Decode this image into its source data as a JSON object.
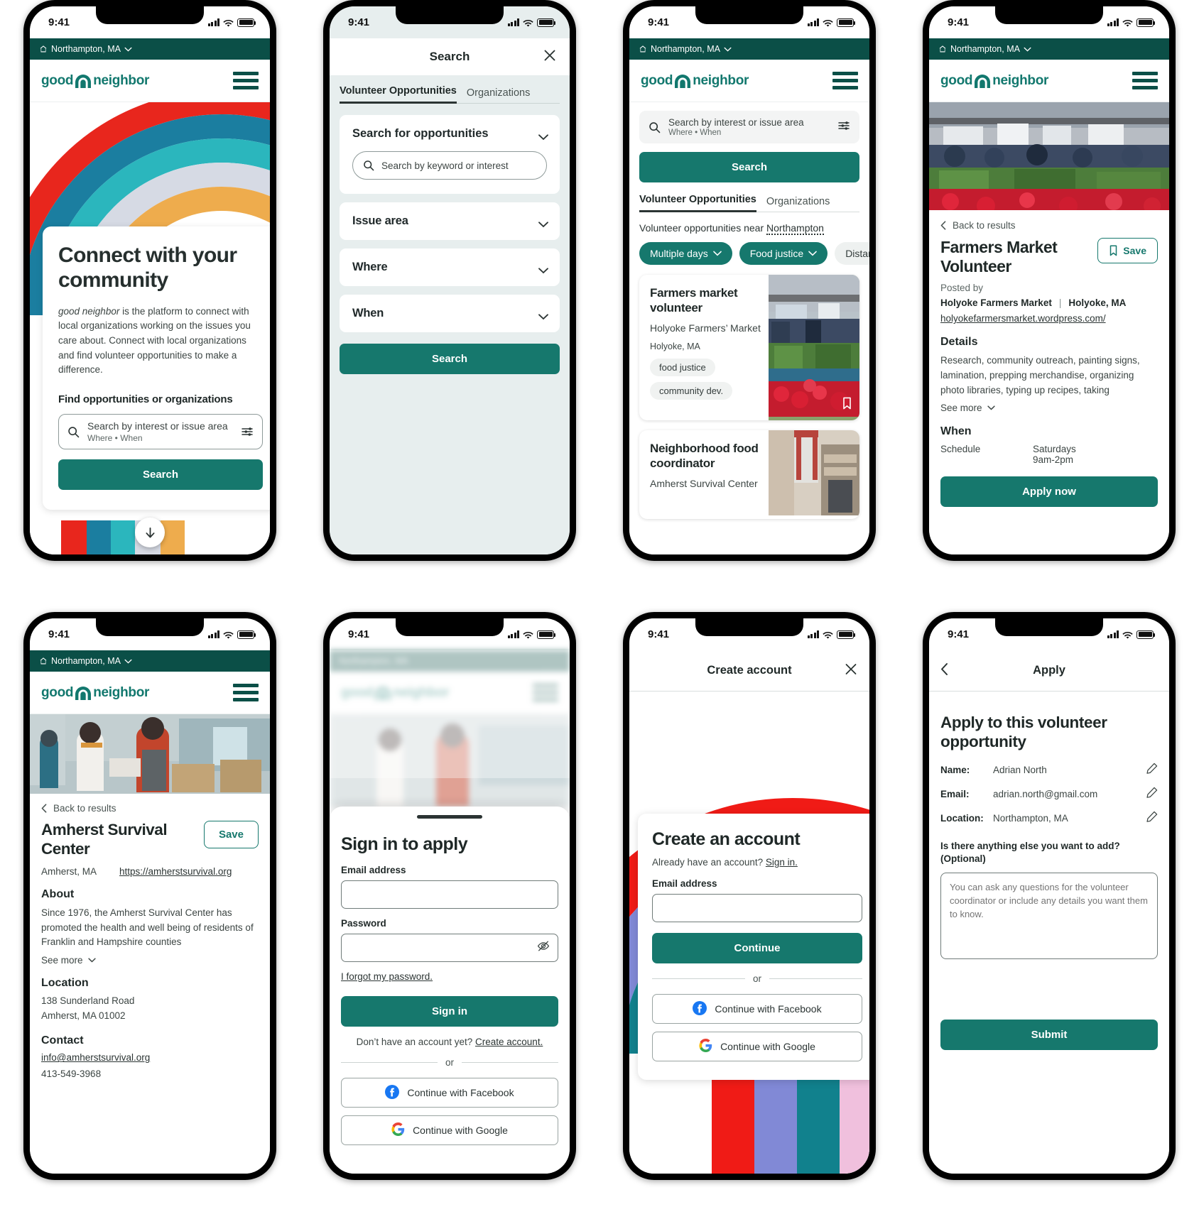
{
  "brand": {
    "name": "good neighbor",
    "name_part1": "good",
    "name_part2": "neighbor",
    "teal": "#16786d",
    "dark_teal": "#0b4f47",
    "rainbow_home": [
      "#e8261d",
      "#1b7ea0",
      "#2bb6bd",
      "#d6dae4",
      "#eeac4d"
    ],
    "rainbow_signup": [
      "#f01b16",
      "#8189d6",
      "#11818d",
      "#f0c0dd"
    ]
  },
  "status_bar": {
    "time": "9:41"
  },
  "location_bar": {
    "label": "Northampton, MA",
    "icon": "home-icon",
    "chevron": "chevron-down-icon"
  },
  "screen1_home": {
    "title": "Connect with your community",
    "paragraph_em": "good neighbor",
    "paragraph": " is the platform to connect with local organizations working on the issues you care about. Connect with local organizations and find volunteer opportunities to make a difference.",
    "find_heading": "Find opportunities or organizations",
    "search_placeholder": "Search by interest or issue area",
    "search_sub": "Where • When",
    "search_button": "Search"
  },
  "screen2_search": {
    "header_title": "Search",
    "close_icon": "close-icon",
    "tabs": [
      {
        "label": "Volunteer Opportunities",
        "active": true
      },
      {
        "label": "Organizations",
        "active": false
      }
    ],
    "sections": [
      {
        "label": "Search for opportunities",
        "expanded": true,
        "input_placeholder": "Search by keyword or interest"
      },
      {
        "label": "Issue area",
        "expanded": false
      },
      {
        "label": "Where",
        "expanded": false
      },
      {
        "label": "When",
        "expanded": false
      }
    ],
    "search_button": "Search"
  },
  "screen3_results": {
    "search_placeholder": "Search by interest or issue area",
    "search_sub": "Where • When",
    "search_button": "Search",
    "tabs": [
      {
        "label": "Volunteer Opportunities",
        "active": true
      },
      {
        "label": "Organizations",
        "active": false
      }
    ],
    "results_heading_prefix": "Volunteer opportunities near ",
    "results_heading_place": "Northampton",
    "filters": [
      {
        "label": "Multiple days",
        "style": "solid",
        "chevron": true
      },
      {
        "label": "Food justice",
        "style": "solid",
        "chevron": true
      },
      {
        "label": "Distance",
        "style": "ghost",
        "chevron": false
      }
    ],
    "cards": [
      {
        "title": "Farmers market volunteer",
        "org": "Holyoke Farmers’ Market",
        "place": "Holyoke, MA",
        "tags": [
          "food justice",
          "community dev."
        ],
        "bookmark_icon": "bookmark-icon"
      },
      {
        "title": "Neighborhood food coordinator",
        "org": "Amherst Survival Center",
        "place": "",
        "tags": []
      }
    ]
  },
  "screen4_detail": {
    "back_label": "Back to results",
    "back_icon": "chevron-left-icon",
    "title": "Farmers Market Volunteer",
    "save_label": "Save",
    "save_icon": "bookmark-icon",
    "posted_by_label": "Posted by",
    "org_name": "Holyoke Farmers Market",
    "org_divider": "|",
    "org_place": "Holyoke, MA",
    "org_url": "holyokefarmersmarket.wordpress.com/",
    "details_heading": "Details",
    "details_text": "Research, community outreach, painting signs, lamination, prepping merchandise, organizing photo libraries, typing up recipes, taking",
    "see_more": "See more",
    "when_heading": "When",
    "schedule_label": "Schedule",
    "schedule_value_1": "Saturdays",
    "schedule_value_2": "9am-2pm",
    "apply_button": "Apply now"
  },
  "screen5_org": {
    "back_label": "Back to results",
    "title": "Amherst Survival Center",
    "save_label": "Save",
    "place": "Amherst, MA",
    "url": "https://amherstsurvival.org",
    "about_heading": "About",
    "about_text": "Since 1976, the Amherst Survival Center has promoted the health and well being of residents of Franklin and Hampshire counties",
    "see_more": "See more",
    "location_heading": "Location",
    "address_line1": "138 Sunderland Road",
    "address_line2": "Amherst, MA 01002",
    "contact_heading": "Contact",
    "contact_email": "info@amherstsurvival.org",
    "contact_phone": "413-549-3968"
  },
  "screen6_signin": {
    "title": "Sign in to apply",
    "email_label": "Email address",
    "email_value": "",
    "password_label": "Password",
    "password_value": "",
    "eye_icon": "eye-off-icon",
    "forgot_link": "I forgot my password.",
    "signin_button": "Sign in",
    "no_account_text": "Don’t have an account yet? ",
    "create_account_link": "Create account.",
    "or": "or",
    "facebook_button": "Continue with Facebook",
    "google_button": "Continue with Google",
    "facebook_icon": "facebook-icon",
    "google_icon": "google-icon"
  },
  "screen7_create": {
    "header_title": "Create account",
    "close_icon": "close-icon",
    "title": "Create an account",
    "already_text": "Already have an account? ",
    "signin_link": "Sign in.",
    "email_label": "Email address",
    "email_value": "",
    "continue_button": "Continue",
    "or": "or",
    "facebook_button": "Continue with Facebook",
    "google_button": "Continue with Google"
  },
  "screen8_apply": {
    "header_title": "Apply",
    "back_icon": "chevron-left-icon",
    "title": "Apply to this volunteer opportunity",
    "rows": [
      {
        "label": "Name:",
        "value": "Adrian North",
        "edit_icon": "pencil-icon"
      },
      {
        "label": "Email:",
        "value": "adrian.north@gmail.com",
        "edit_icon": "pencil-icon"
      },
      {
        "label": "Location:",
        "value": "Northampton, MA",
        "edit_icon": "pencil-icon"
      }
    ],
    "question_label": "Is there anything else you want to add? (Optional)",
    "textarea_placeholder": "You can ask any questions for the volunteer coordinator or include any details you want them to know.",
    "textarea_value": "",
    "submit_button": "Submit"
  }
}
